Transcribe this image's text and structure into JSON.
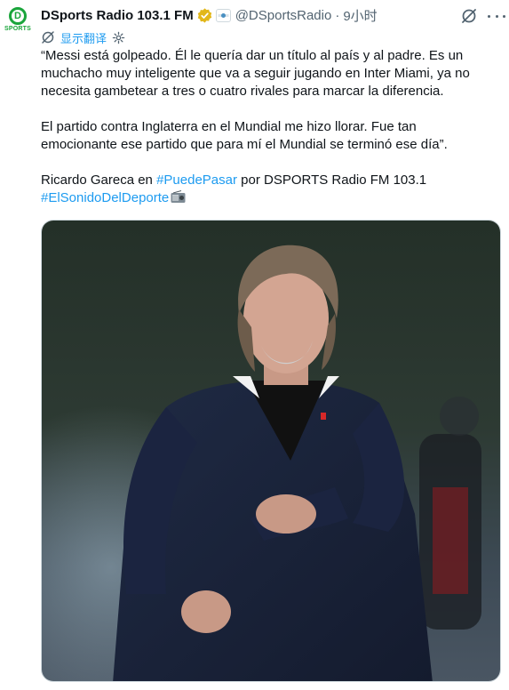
{
  "account": {
    "avatar_text": "SPORTS",
    "avatar_letter": "D",
    "name": "DSports Radio 103.1 FM",
    "handle": "@DSportsRadio",
    "separator": "·",
    "time": "9小时"
  },
  "translate": {
    "label": "显示翻译"
  },
  "tweet": {
    "lines": [
      "“Messi está golpeado. Él le quería dar un título al país y al padre. Es un",
      "muchacho muy inteligente que va a seguir jugando en Inter Miami, ya no",
      "necesita gambetear a tres o cuatro rivales para marcar la diferencia.",
      "El partido contra Inglaterra en el Mundial me hizo llorar. Fue tan",
      "emocionante ese partido que para mí el Mundial se terminó ese día”."
    ],
    "credit_prefix": "Ricardo Gareca en ",
    "hashtag1": "#PuedePasar",
    "credit_suffix": " por DSPORTS Radio FM 103.1",
    "hashtag2": "#ElSonidoDelDeporte"
  },
  "icons": {
    "verified": "verified-badge-icon",
    "affiliate": "affiliate-badge-icon",
    "grok": "grok-icon",
    "more": "more-icon",
    "translate": "translate-icon",
    "settings": "settings-icon",
    "radio": "radio-emoji-icon"
  },
  "colors": {
    "link": "#1d9bf0",
    "verified_gold": "#e2b719",
    "brand_green": "#1aa53b",
    "secondary_text": "#536471"
  }
}
